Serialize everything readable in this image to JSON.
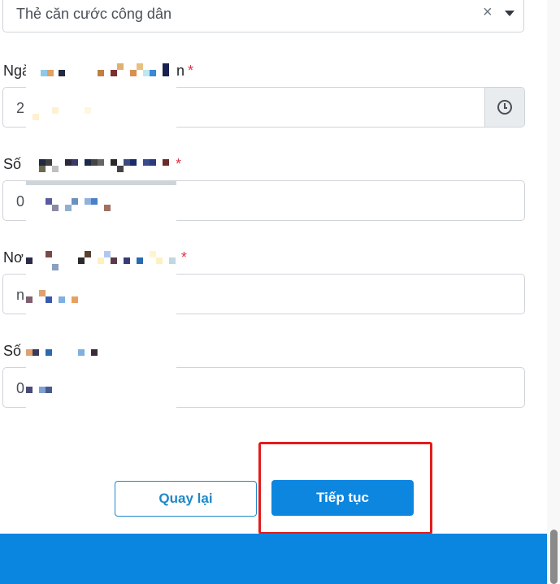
{
  "document_type": {
    "selected": "Thẻ căn cước công dân",
    "clear_symbol": "×"
  },
  "fields": [
    {
      "label_visible": "Ngà",
      "label_tail": "n",
      "required": "*",
      "value_visible": "2"
    },
    {
      "label_visible": "Số",
      "required": "*",
      "value_visible": "0"
    },
    {
      "label_visible": "Nơ",
      "required": "*",
      "value_visible": "n"
    },
    {
      "label_visible": "Số",
      "value_visible": "0"
    }
  ],
  "actions": {
    "back_label": "Quay lại",
    "next_label": "Tiếp tục"
  },
  "colors": {
    "primary": "#0d86e0",
    "outline": "#1e88c8",
    "required": "#dc3545",
    "highlight": "#e41b1b"
  },
  "icons": {
    "date_picker": "clock-icon",
    "dropdown": "chevron-down-icon"
  }
}
